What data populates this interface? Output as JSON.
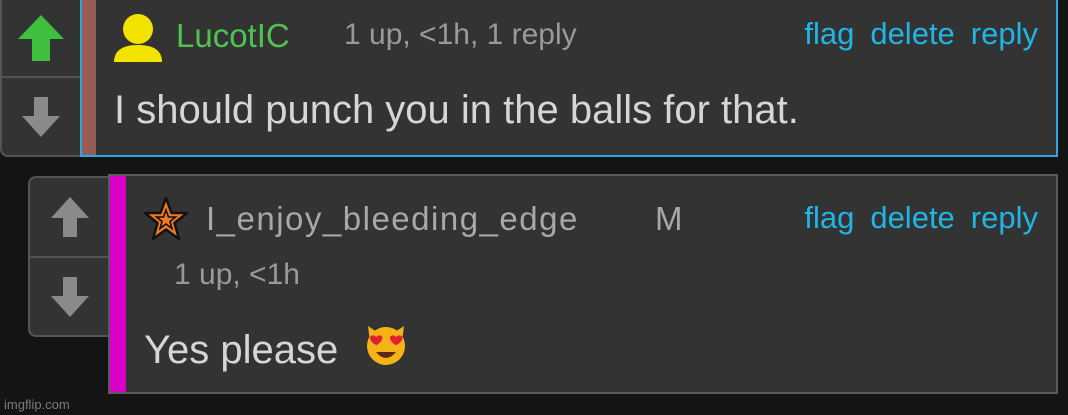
{
  "comments": [
    {
      "username": "LucotIC",
      "meta": "1 up, <1h, 1 reply",
      "body": "I should punch you in the balls for that.",
      "actions": [
        "flag",
        "delete",
        "reply"
      ],
      "avatar_icon": "user-silhouette-icon",
      "upvoted": true,
      "colors": {
        "username": "#4fc24f",
        "bar": "#9a5a55",
        "border": "#29a9e0",
        "upvote": "#3fbf3f",
        "avatar": "#f2e400"
      }
    },
    {
      "username": "I_enjoy_bleeding_edge",
      "badge": "M",
      "meta": "1 up, <1h",
      "body": "Yes please",
      "emoji": "😻",
      "actions": [
        "flag",
        "delete",
        "reply"
      ],
      "avatar_icon": "star-icon",
      "upvoted": false,
      "colors": {
        "username": "#a8a8a8",
        "bar": "#d800c8",
        "border": "#5a5a5a",
        "avatar": "#f07a20"
      }
    }
  ],
  "watermark": "imgflip.com"
}
